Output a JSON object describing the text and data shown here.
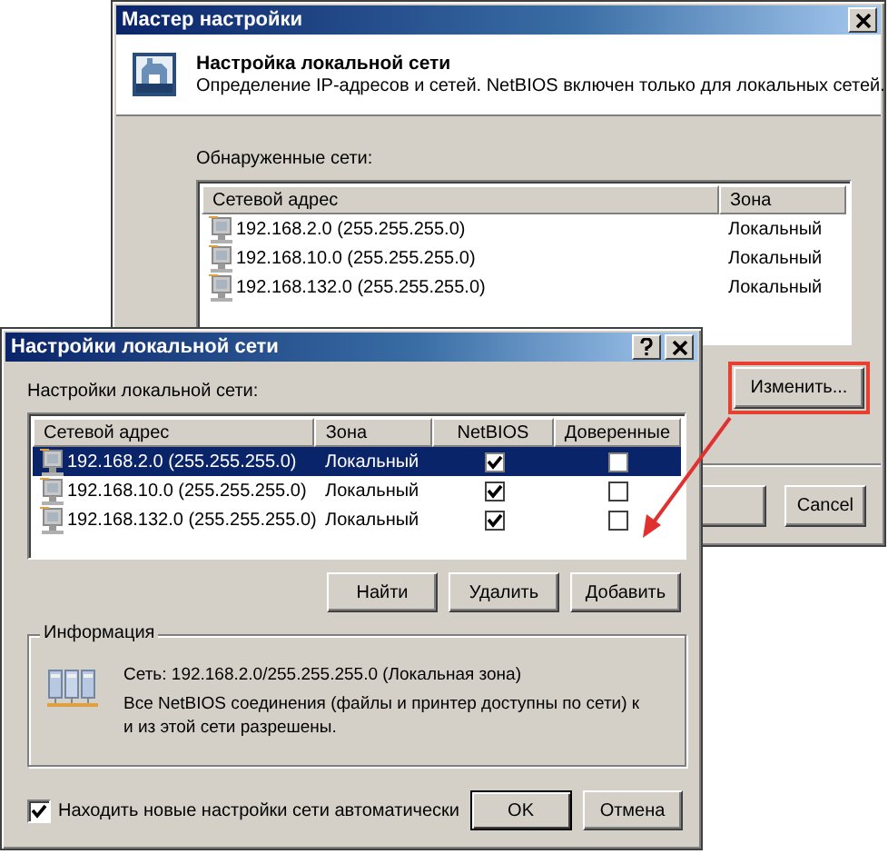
{
  "wizard": {
    "title": "Мастер настройки",
    "heading": "Настройка локальной сети",
    "subheading": "Определение IP-адресов и сетей. NetBIOS включен только для локальных сетей.",
    "list_label": "Обнаруженные сети:",
    "columns": [
      "Сетевой адрес",
      "Зона"
    ],
    "rows": [
      {
        "address": "192.168.2.0 (255.255.255.0)",
        "zone": "Локальный"
      },
      {
        "address": "192.168.10.0 (255.255.255.0)",
        "zone": "Локальный"
      },
      {
        "address": "192.168.132.0 (255.255.255.0)",
        "zone": "Локальный"
      }
    ],
    "edit_button": {
      "label": "Изменить...",
      "highlighted": true
    },
    "buttons": [
      "Cancel"
    ]
  },
  "dialog": {
    "title": "Настройки локальной сети",
    "list_label": "Настройки локальной сети:",
    "columns": [
      "Сетевой адрес",
      "Зона",
      "NetBIOS",
      "Доверенные"
    ],
    "rows": [
      {
        "address": "192.168.2.0 (255.255.255.0)",
        "zone": "Локальный",
        "netbios": true,
        "trusted": false,
        "selected": true
      },
      {
        "address": "192.168.10.0 (255.255.255.0)",
        "zone": "Локальный",
        "netbios": true,
        "trusted": false,
        "selected": false
      },
      {
        "address": "192.168.132.0 (255.255.255.0)",
        "zone": "Локальный",
        "netbios": true,
        "trusted": false,
        "selected": false
      }
    ],
    "buttons": [
      "Найти",
      "Удалить",
      "Добавить"
    ],
    "info": {
      "title": "Информация",
      "network": "Сеть: 192.168.2.0/255.255.255.0 (Локальная зона)",
      "description": "Все NetBIOS соединения (файлы и принтер доступны по сети) к\nи из этой сети разрешены."
    },
    "auto_detect": {
      "label": "Находить новые настройки сети автоматически",
      "checked": true
    },
    "footer_buttons": [
      "OK",
      "Отмена"
    ]
  }
}
